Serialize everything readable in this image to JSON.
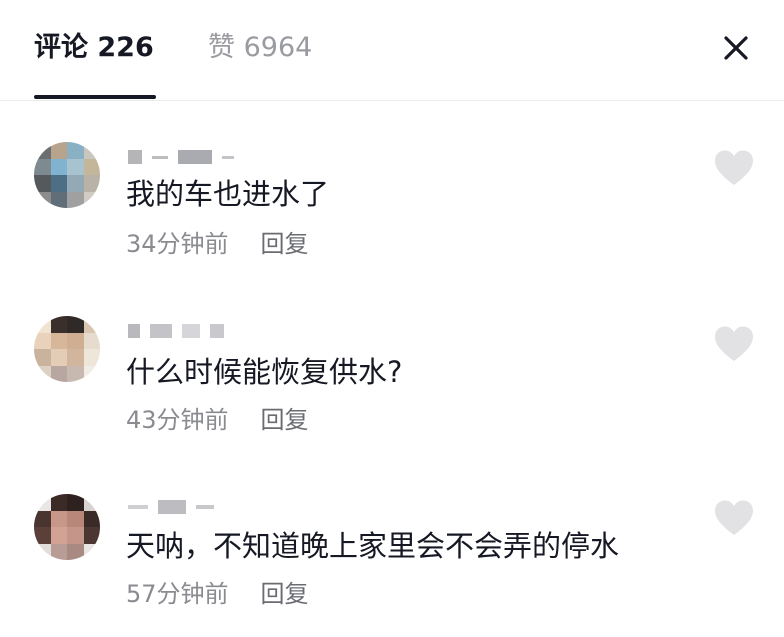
{
  "tabs": {
    "comments_label": "评论 226",
    "likes_label": "赞 6964"
  },
  "icons": {
    "close": "close-icon",
    "like": "heart-outline-icon"
  },
  "colors": {
    "primary_text": "#161823",
    "secondary_text": "#8a8b91",
    "heart": "#e2e2e4"
  },
  "comments": [
    {
      "text": "我的车也进水了",
      "time": "34分钟前",
      "reply": "回复"
    },
    {
      "text": "什么时候能恢复供水?",
      "time": "43分钟前",
      "reply": "回复"
    },
    {
      "text": "天呐，不知道晚上家里会不会弄的停水",
      "time": "57分钟前",
      "reply": "回复"
    }
  ]
}
